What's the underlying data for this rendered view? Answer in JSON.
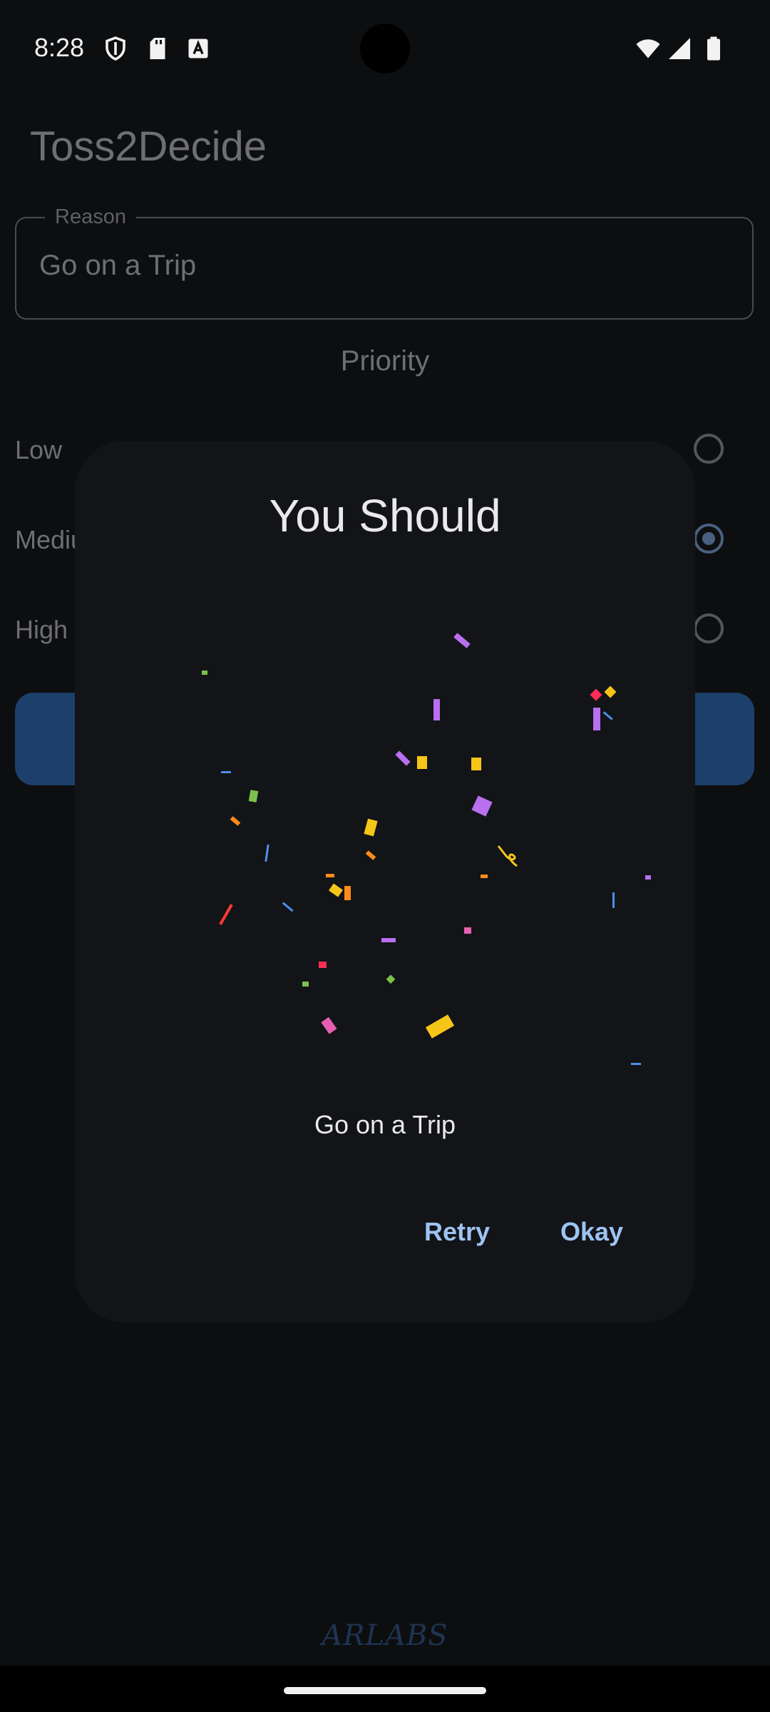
{
  "status_bar": {
    "time": "8:28",
    "icons": [
      "shield-icon",
      "sd-card-icon",
      "keyboard-a-icon",
      "wifi-icon",
      "signal-icon",
      "battery-icon"
    ]
  },
  "app": {
    "title": "Toss2Decide",
    "reason": {
      "label": "Reason",
      "value": "Go on a Trip"
    },
    "priority": {
      "heading": "Priority",
      "options": [
        {
          "label": "Low",
          "selected": false
        },
        {
          "label": "Medium",
          "selected": true
        },
        {
          "label": "High",
          "selected": false
        }
      ]
    }
  },
  "dialog": {
    "title": "You Should",
    "result": "Go on a Trip",
    "retry_label": "Retry",
    "okay_label": "Okay"
  },
  "footer": {
    "brand": "ARLABS"
  },
  "colors": {
    "background": "#0d0e10",
    "dialog": "#121418",
    "accent_button": "#1d3f6b",
    "dialog_button_text": "#9ec3f2"
  }
}
